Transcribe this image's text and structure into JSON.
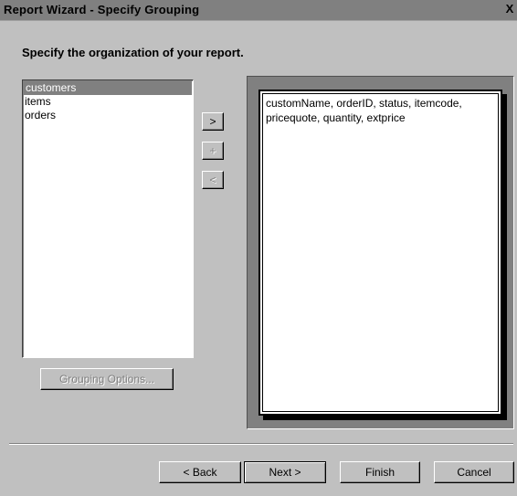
{
  "window": {
    "title": "Report Wizard - Specify Grouping",
    "close_label": "X"
  },
  "heading": "Specify the organization of your report.",
  "tables_list": {
    "items": [
      "customers",
      "items",
      "orders"
    ],
    "selected": "customers"
  },
  "move_buttons": {
    "add": ">",
    "plus": "+",
    "remove": "<"
  },
  "grouping_options_label": "Grouping Options...",
  "grouping_preview": {
    "lines": [
      "customName, orderID, status, itemcode,",
      "pricequote, quantity, extprice"
    ]
  },
  "footer": {
    "back": "< Back",
    "next": "Next >",
    "finish": "Finish",
    "cancel": "Cancel"
  }
}
